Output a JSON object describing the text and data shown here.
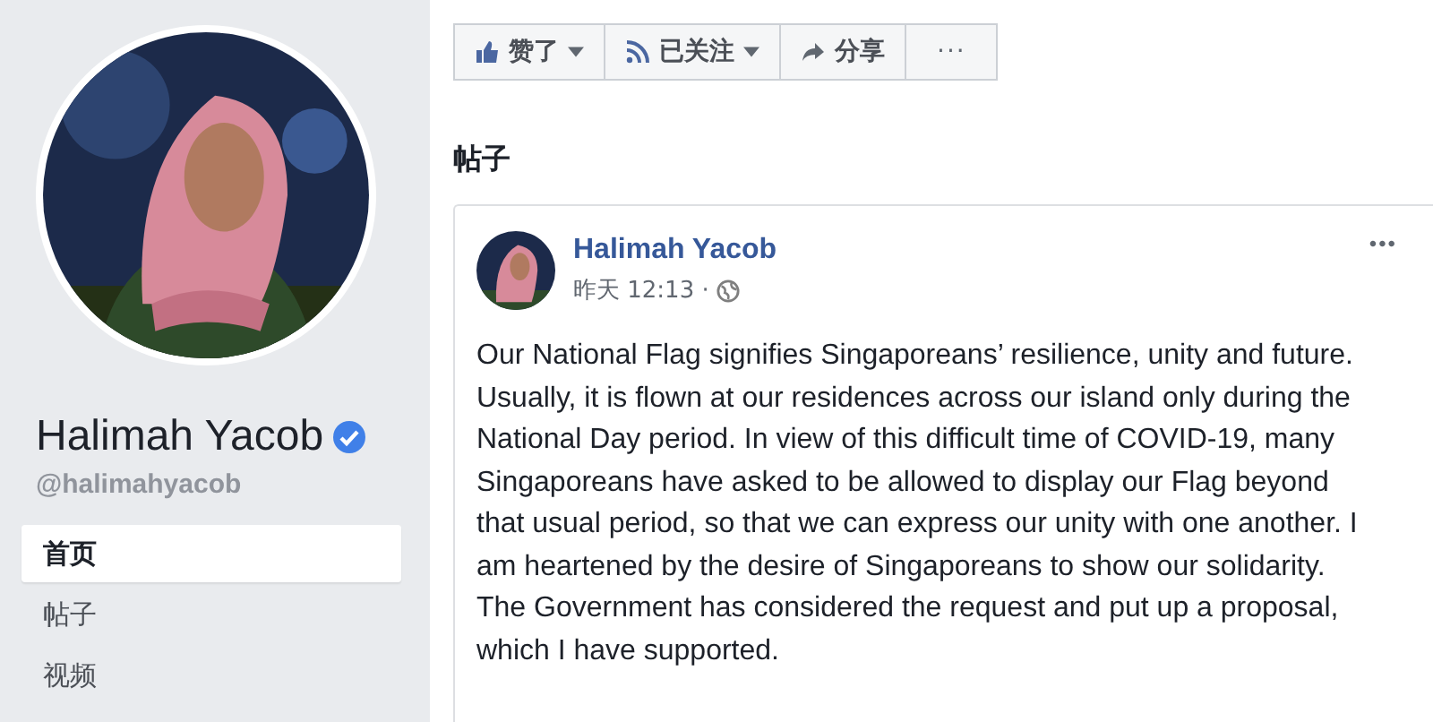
{
  "profile": {
    "name": "Halimah Yacob",
    "verified": true,
    "handle": "@halimahyacob"
  },
  "nav": [
    {
      "label": "首页",
      "selected": true
    },
    {
      "label": "帖子",
      "selected": false
    },
    {
      "label": "视频",
      "selected": false
    }
  ],
  "actions": [
    {
      "kind": "like",
      "label": "赞了",
      "dropdown": true
    },
    {
      "kind": "follow",
      "label": "已关注",
      "dropdown": true
    },
    {
      "kind": "share",
      "label": "分享",
      "dropdown": false
    },
    {
      "kind": "more",
      "label": "···",
      "dropdown": false
    }
  ],
  "section_title": "帖子",
  "post": {
    "author": "Halimah Yacob",
    "time": "昨天 12:13 ·",
    "menu": "•••",
    "text": "Our National Flag signifies Singaporeans’ resilience, unity and future. Usually, it is flown at our residences across our island only during the National Day period. In view of this difficult time of COVID-19, many Singaporeans have asked to be allowed to display our Flag beyond that usual period, so that we can express our unity with one another. I am heartened by the desire of Singaporeans to show our solidarity. The Government has considered the request and put up a proposal, which I have supported."
  }
}
